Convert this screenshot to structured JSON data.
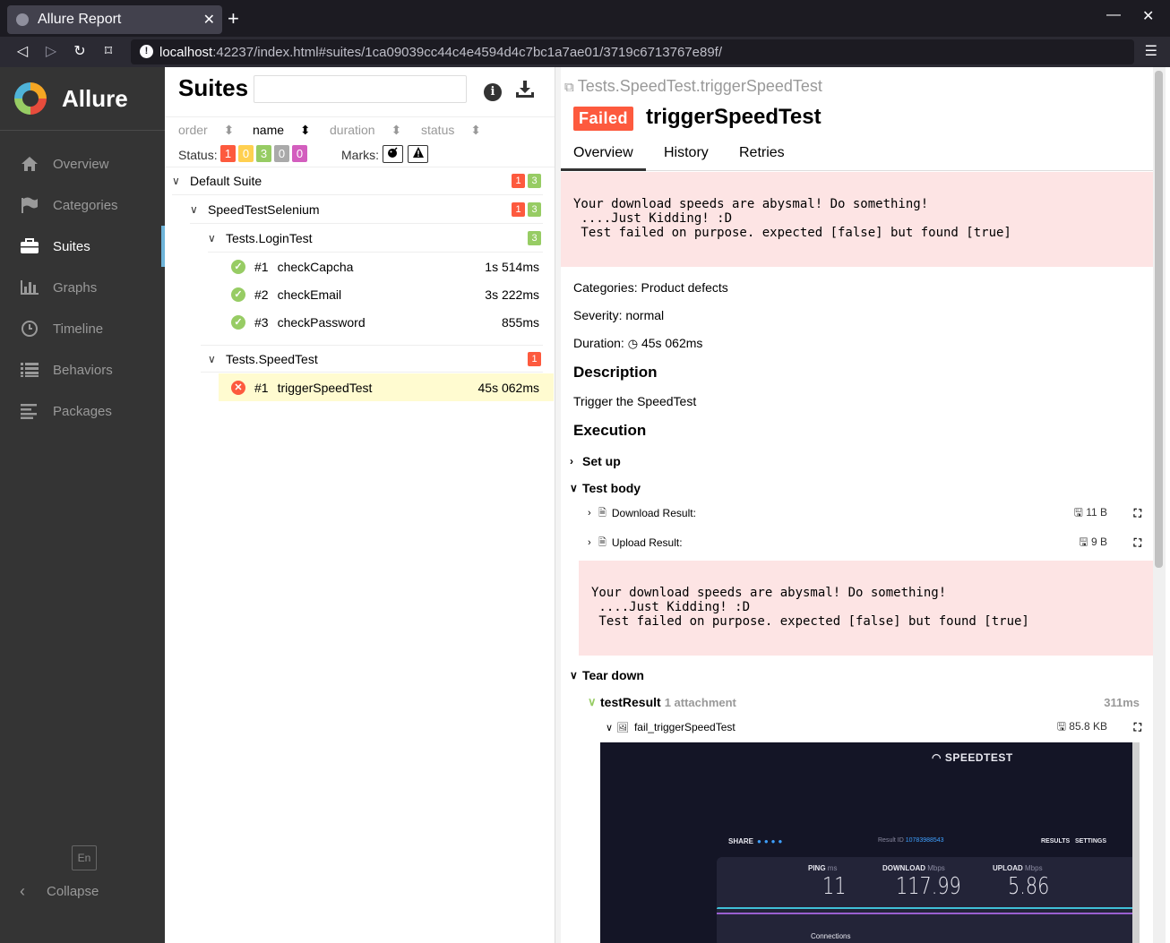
{
  "browser": {
    "tab_title": "Allure Report",
    "url_host": "localhost",
    "url_rest": ":42237/index.html#suites/1ca09039cc44c4e4594d4c7bc1a7ae01/3719c6713767e89f/"
  },
  "sidebar": {
    "brand": "Allure",
    "items": [
      {
        "label": "Overview",
        "icon": "home-icon"
      },
      {
        "label": "Categories",
        "icon": "flag-icon"
      },
      {
        "label": "Suites",
        "icon": "briefcase-icon",
        "active": true
      },
      {
        "label": "Graphs",
        "icon": "bar-chart-icon"
      },
      {
        "label": "Timeline",
        "icon": "clock-icon"
      },
      {
        "label": "Behaviors",
        "icon": "list-icon"
      },
      {
        "label": "Packages",
        "icon": "align-left-icon"
      }
    ],
    "language": "En",
    "collapse": "Collapse"
  },
  "suites": {
    "title": "Suites",
    "sort": {
      "order": "order",
      "name": "name",
      "duration": "duration",
      "status": "status"
    },
    "status_label": "Status:",
    "status_counts": [
      "1",
      "0",
      "3",
      "0",
      "0"
    ],
    "marks_label": "Marks:",
    "tree": {
      "default_suite": {
        "label": "Default Suite",
        "failed": "1",
        "passed": "3"
      },
      "selenium": {
        "label": "SpeedTestSelenium",
        "failed": "1",
        "passed": "3"
      },
      "login": {
        "label": "Tests.LoginTest",
        "passed": "3"
      },
      "login_tests": [
        {
          "num": "#1",
          "name": "checkCapcha",
          "dur": "1s 514ms"
        },
        {
          "num": "#2",
          "name": "checkEmail",
          "dur": "3s 222ms"
        },
        {
          "num": "#3",
          "name": "checkPassword",
          "dur": "855ms"
        }
      ],
      "speed": {
        "label": "Tests.SpeedTest",
        "failed": "1"
      },
      "speed_tests": [
        {
          "num": "#1",
          "name": "triggerSpeedTest",
          "dur": "45s 062ms"
        }
      ]
    }
  },
  "detail": {
    "path": "Tests.SpeedTest.triggerSpeedTest",
    "status": "Failed",
    "name": "triggerSpeedTest",
    "tabs": [
      "Overview",
      "History",
      "Retries"
    ],
    "error": "Your download speeds are abysmal! Do something!\n ....Just Kidding! :D\n Test failed on purpose. expected [false] but found [true]",
    "categories": "Categories: Product defects",
    "severity": "Severity: normal",
    "duration_label": "Duration:",
    "duration": "45s 062ms",
    "description_title": "Description",
    "description": "Trigger the SpeedTest",
    "execution_title": "Execution",
    "setup": "Set up",
    "test_body": "Test body",
    "attachments": [
      {
        "name": "Download Result:",
        "size": "11 B"
      },
      {
        "name": "Upload Result:",
        "size": "9 B"
      }
    ],
    "teardown": "Tear down",
    "step": {
      "name": "testResult",
      "attachments": "1 attachment",
      "dur": "311ms"
    },
    "screenshot_att": {
      "name": "fail_triggerSpeedTest",
      "size": "85.8 KB"
    }
  },
  "speedtest": {
    "logo": "SPEEDTEST",
    "share": "SHARE",
    "result_label": "Result ID",
    "result_id": "10783988543",
    "results": "RESULTS",
    "settings": "SETTINGS",
    "ping_label": "PING",
    "ping_unit": "ms",
    "ping": "11",
    "download_label": "DOWNLOAD",
    "download_unit": "Mbps",
    "download": "117.99",
    "upload_label": "UPLOAD",
    "upload_unit": "Mbps",
    "upload": "5.86",
    "connections": "Connections"
  }
}
